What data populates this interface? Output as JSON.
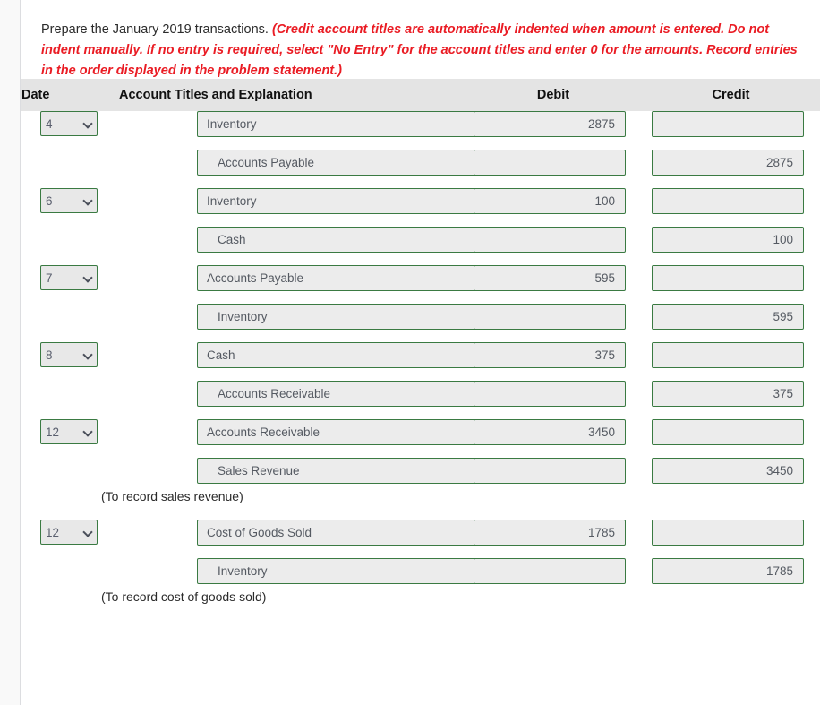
{
  "instructions": {
    "lead": "Prepare the January 2019 transactions.",
    "note": "(Credit account titles are automatically indented when amount is entered. Do not indent manually. If no entry is required, select \"No Entry\" for the account titles and enter 0 for the amounts. Record entries in the order displayed in the problem statement.)"
  },
  "table": {
    "headers": {
      "date": "Date",
      "account": "Account Titles and Explanation",
      "debit": "Debit",
      "credit": "Credit"
    },
    "entries": [
      {
        "date": "n. 4",
        "lines": [
          {
            "account": "Inventory",
            "indent": false,
            "debit": "2875",
            "credit": ""
          },
          {
            "account": "Accounts Payable",
            "indent": true,
            "debit": "",
            "credit": "2875"
          }
        ],
        "memo": ""
      },
      {
        "date": "n. 6",
        "lines": [
          {
            "account": "Inventory",
            "indent": false,
            "debit": "100",
            "credit": ""
          },
          {
            "account": "Cash",
            "indent": true,
            "debit": "",
            "credit": "100"
          }
        ],
        "memo": ""
      },
      {
        "date": "n. 7",
        "lines": [
          {
            "account": "Accounts Payable",
            "indent": false,
            "debit": "595",
            "credit": ""
          },
          {
            "account": "Inventory",
            "indent": true,
            "debit": "",
            "credit": "595"
          }
        ],
        "memo": ""
      },
      {
        "date": "n. 8",
        "lines": [
          {
            "account": "Cash",
            "indent": false,
            "debit": "375",
            "credit": ""
          },
          {
            "account": "Accounts Receivable",
            "indent": true,
            "debit": "",
            "credit": "375"
          }
        ],
        "memo": ""
      },
      {
        "date": "n. 12",
        "lines": [
          {
            "account": "Accounts Receivable",
            "indent": false,
            "debit": "3450",
            "credit": ""
          },
          {
            "account": "Sales Revenue",
            "indent": true,
            "debit": "",
            "credit": "3450"
          }
        ],
        "memo": "(To record sales revenue)"
      },
      {
        "date": "n. 12",
        "lines": [
          {
            "account": "Cost of Goods Sold",
            "indent": false,
            "debit": "1785",
            "credit": ""
          },
          {
            "account": "Inventory",
            "indent": true,
            "debit": "",
            "credit": "1785"
          }
        ],
        "memo": "(To record cost of goods sold)"
      }
    ]
  },
  "colors": {
    "field_border": "#3a7a42",
    "field_fill": "#ececec",
    "header_fill": "#e4e4e4",
    "note_text": "#ea1c24"
  }
}
